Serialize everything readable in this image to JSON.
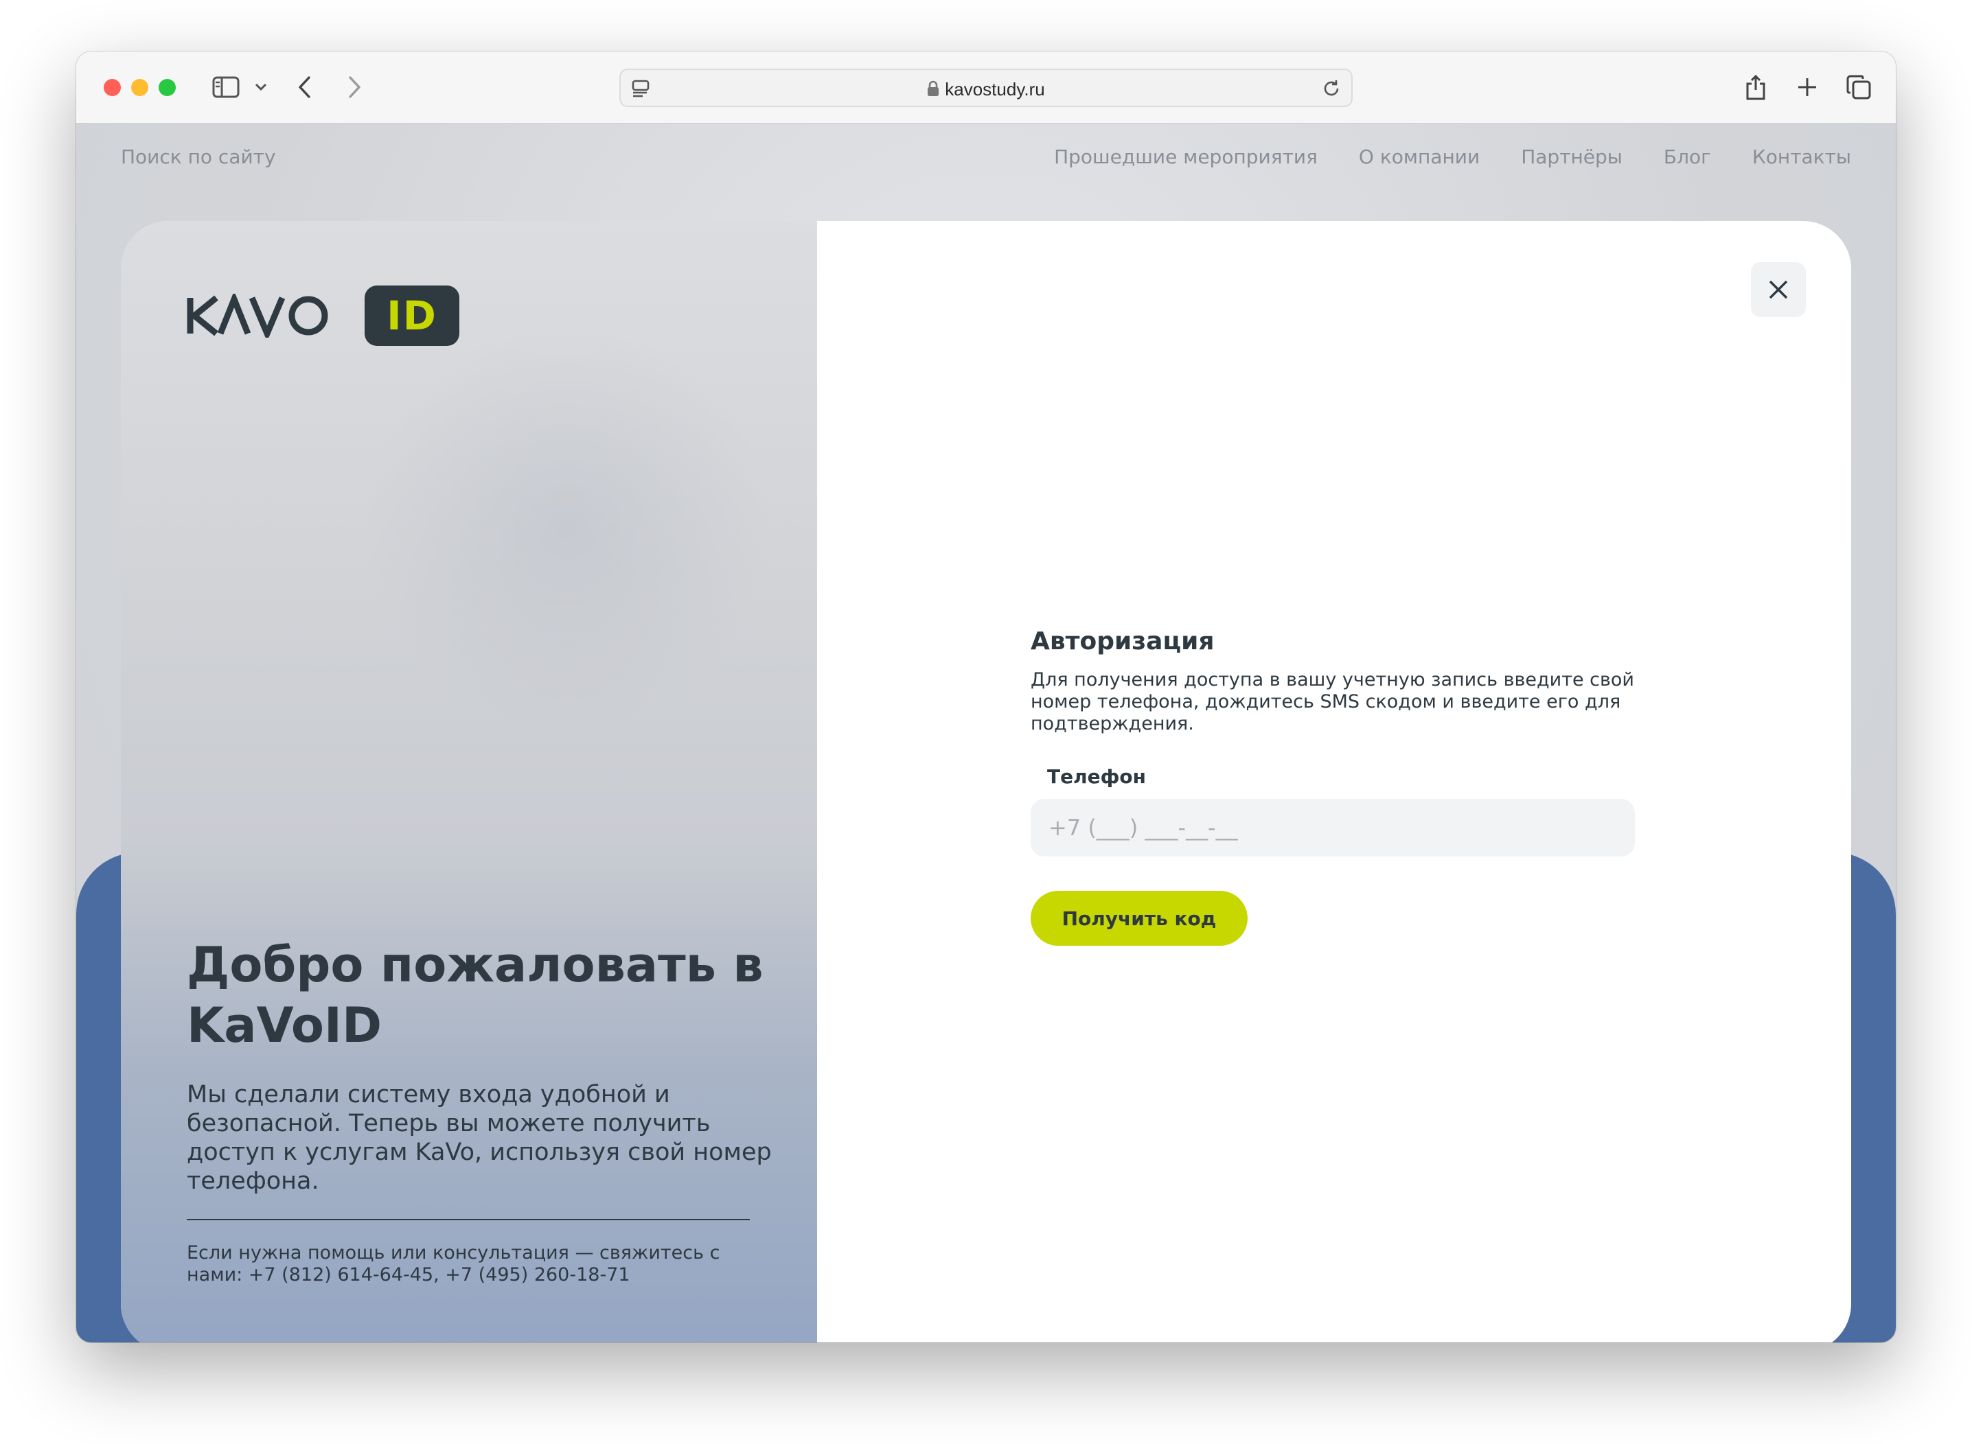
{
  "browser": {
    "url": "kavostudy.ru",
    "icons": [
      "sidebar-icon",
      "chevron-down-icon",
      "back-icon",
      "forward-icon",
      "reader-icon",
      "lock-icon",
      "reload-icon",
      "share-icon",
      "new-tab-icon",
      "tabs-overview-icon"
    ]
  },
  "site_nav": {
    "search_label": "Поиск по сайту",
    "links": [
      "Прошедшие мероприятия",
      "О компании",
      "Партнёры",
      "Блог",
      "Контакты"
    ]
  },
  "modal": {
    "logo_text": "KAVO",
    "logo_badge": "ID",
    "welcome_title": "Добро пожаловать в KaVoID",
    "welcome_text": "Мы сделали систему входа удобной и безопасной. Теперь вы можете получить доступ к услугам KaVo, используя свой номер телефона.",
    "help_text": "Если нужна помощь или консультация — свяжитесь с нами: +7 (812) 614-64-45, +7 (495) 260-18-71",
    "auth_title": "Авторизация",
    "auth_desc": "Для получения доступа в вашу учетную запись введите свой номер телефона, дождитесь SMS скодом и введите его для подтверждения.",
    "phone_label": "Телефон",
    "phone_value": "",
    "phone_placeholder": "+7 (___) ___-__-__",
    "submit_label": "Получить код"
  },
  "colors": {
    "accent": "#c7d800",
    "dark": "#2e3942",
    "blue_band": "#4a6ca0"
  }
}
